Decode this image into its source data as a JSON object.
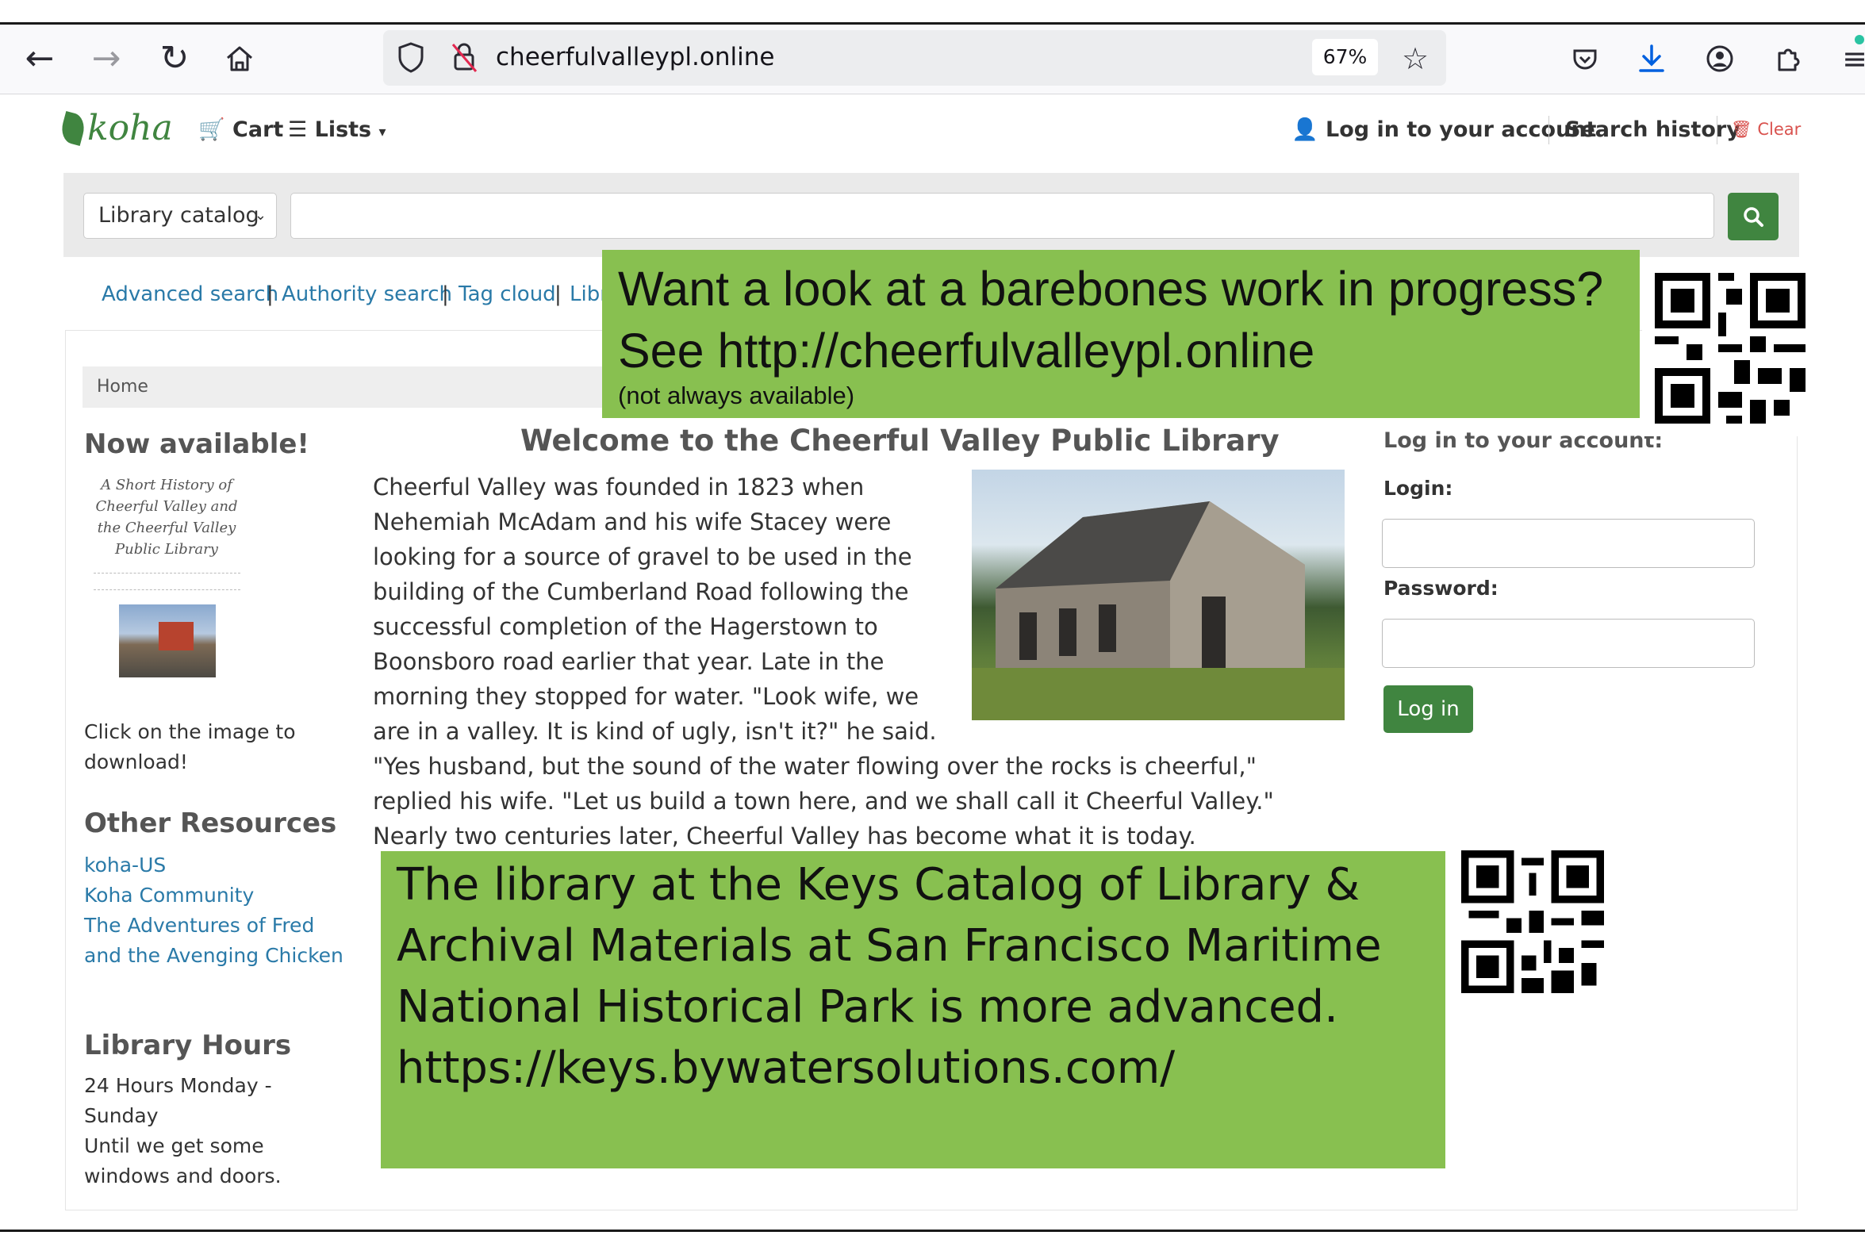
{
  "browser": {
    "url": "cheerfulvalleypl.online",
    "zoom": "67%",
    "icons": [
      "back-arrow-icon",
      "forward-arrow-icon",
      "reload-icon",
      "home-icon",
      "shield-icon",
      "no-lock-icon",
      "star-icon",
      "pocket-icon",
      "download-icon",
      "account-icon",
      "extensions-icon",
      "menu-icon"
    ]
  },
  "koha": {
    "logo": "koha",
    "cart": "Cart",
    "lists": "Lists",
    "login_link": "Log in to your account",
    "search_history": "Search history",
    "clear": "Clear",
    "catalog_select": "Library catalog",
    "adv_links": [
      "Advanced search",
      "Authority search",
      "Tag cloud",
      "Libr"
    ],
    "breadcrumb": "Home"
  },
  "left": {
    "now_available": "Now available!",
    "book_title": "A Short History of Cheerful Valley and the Cheerful Valley Public Library",
    "click_text": "Click on the image to download!",
    "other_resources": "Other Resources",
    "resources": [
      "koha-US",
      "Koha Community",
      "The Adventures of Fred and the Avenging Chicken"
    ],
    "hours_title": "Library Hours",
    "hours_text": "24 Hours Monday - Sunday",
    "hours_note": "Until we get some windows and doors."
  },
  "main": {
    "welcome": "Welcome to the Cheerful Valley Public Library",
    "story": "Cheerful Valley was founded in 1823 when Nehemiah McAdam and his wife Stacey were looking for a source of gravel to be used in the building of the Cumberland Road following the successful completion of the Hagerstown to Boonsboro road earlier that year. Late in the morning they stopped for water. \"Look wife, we are in a valley. It is kind of ugly, isn't it?\" he said. \"Yes husband, but the sound of the water flowing over the rocks is cheerful,\" replied his wife. \"Let us build a town here, and we shall call it Cheerful Valley.\" Nearly two centuries later, Cheerful Valley has become what it is today."
  },
  "login": {
    "heading": "Log in to your account:",
    "login_label": "Login:",
    "password_label": "Password:",
    "button": "Log in"
  },
  "callouts": {
    "top_big": "Want a look at a barebones work in progress? See http://cheerfulvalleypl.online",
    "top_small": "(not always available)",
    "bottom": "The library at the Keys Catalog of Library & Archival Materials at San Francisco Maritime National Historical Park is more advanced. https://keys.bywatersolutions.com/"
  },
  "colors": {
    "koha_green": "#408540",
    "callout_green": "#88c050",
    "link_blue": "#2a7aa8"
  }
}
